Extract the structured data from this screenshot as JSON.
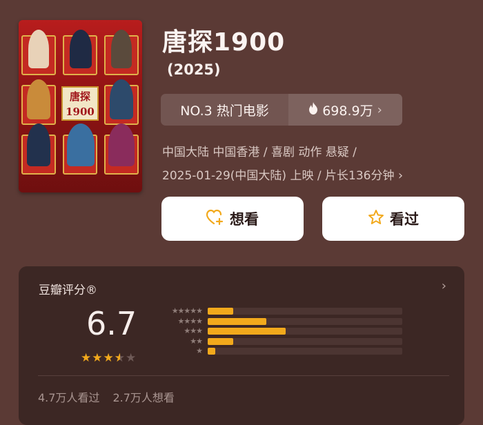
{
  "movie": {
    "title": "唐探1900",
    "year": "(2025)",
    "poster_title": "唐探\n1900"
  },
  "ranking": {
    "rank_label": "NO.3 热门电影",
    "heat_value": "698.9万",
    "heat_icon": "flame-icon"
  },
  "meta": {
    "line1": "中国大陆 中国香港 / 喜剧 动作 悬疑 /",
    "line2": "2025-01-29(中国大陆) 上映 / 片长136分钟"
  },
  "actions": {
    "want_label": "想看",
    "seen_label": "看过"
  },
  "rating": {
    "title": "豆瓣评分®",
    "score": "6.7",
    "stars": [
      1,
      1,
      1,
      0.5,
      0
    ],
    "distribution": [
      {
        "stars": 5,
        "fraction": 0.13
      },
      {
        "stars": 4,
        "fraction": 0.3
      },
      {
        "stars": 3,
        "fraction": 0.4
      },
      {
        "stars": 2,
        "fraction": 0.13
      },
      {
        "stars": 1,
        "fraction": 0.04
      }
    ],
    "watched": "4.7万人看过",
    "want": "2.7万人想看"
  },
  "colors": {
    "background": "#5b3a35",
    "accent": "#f2a91c",
    "card": "#3c2724"
  }
}
